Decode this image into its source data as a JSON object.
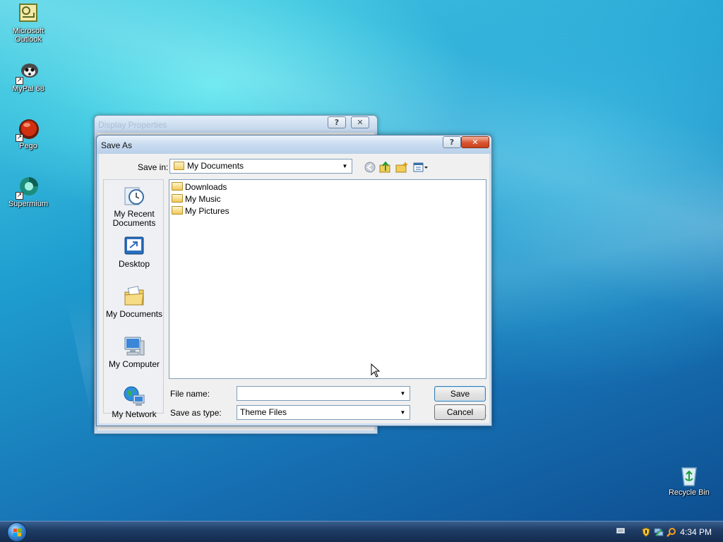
{
  "desktop": {
    "icons": [
      {
        "label_line1": "Microsoft",
        "label_line2": "Outlook"
      },
      {
        "label_line1": "MyPal 68",
        "label_line2": ""
      },
      {
        "label_line1": "Pego",
        "label_line2": ""
      },
      {
        "label_line1": "Supermium",
        "label_line2": ""
      },
      {
        "label_line1": "Recycle Bin",
        "label_line2": ""
      }
    ]
  },
  "background_window": {
    "title": "Display Properties",
    "help_label": "?",
    "close_label": "✕"
  },
  "dialog": {
    "title": "Save As",
    "help_label": "?",
    "close_label": "✕",
    "save_in_label": "Save in:",
    "save_in_value": "My Documents",
    "toolbar_icons": [
      "back-icon",
      "up-folder-icon",
      "new-folder-icon",
      "views-menu-icon"
    ],
    "places": [
      {
        "line1": "My Recent",
        "line2": "Documents",
        "icon": "recent-documents-icon"
      },
      {
        "line1": "Desktop",
        "line2": "",
        "icon": "desktop-icon"
      },
      {
        "line1": "My Documents",
        "line2": "",
        "icon": "my-documents-icon"
      },
      {
        "line1": "My Computer",
        "line2": "",
        "icon": "my-computer-icon"
      },
      {
        "line1": "My Network",
        "line2": "",
        "icon": "my-network-icon"
      }
    ],
    "files": [
      {
        "name": "Downloads",
        "icon": "folder-icon"
      },
      {
        "name": "My Music",
        "icon": "folder-music-icon"
      },
      {
        "name": "My Pictures",
        "icon": "folder-pictures-icon"
      }
    ],
    "file_name_label": "File name:",
    "file_name_value": "",
    "save_as_type_label": "Save as type:",
    "save_as_type_value": "Theme Files",
    "save_button": "Save",
    "cancel_button": "Cancel"
  },
  "taskbar": {
    "clock": "4:34 PM",
    "tray_icons": [
      "keyboard-icon",
      "security-shield-icon",
      "network-icon",
      "search-icon"
    ]
  },
  "colors": {
    "taskbar": "#1f3d66",
    "dialog_frame": "#cfdff0",
    "close_button": "#d9542f"
  }
}
